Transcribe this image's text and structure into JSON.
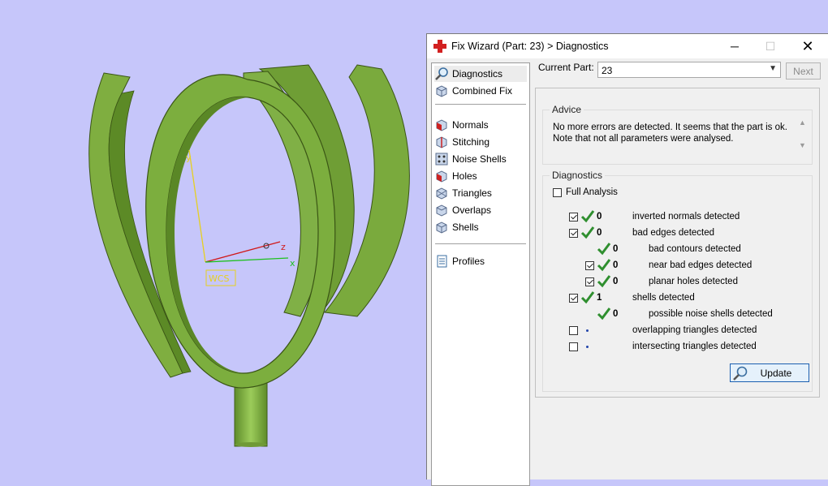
{
  "viewport": {
    "axis_labels": {
      "x": "x",
      "y": "y",
      "z": "z"
    },
    "wcs_label": "WCS"
  },
  "dialog": {
    "title": "Fix Wizard (Part: 23) > Diagnostics",
    "window_buttons": {
      "minimize": "─",
      "maximize": "☐",
      "close": "✕"
    },
    "nav": {
      "items": [
        {
          "label": "Diagnostics",
          "icon": "magnifier-icon"
        },
        {
          "label": "Combined Fix",
          "icon": "cube-icon"
        },
        {
          "label": "Normals",
          "icon": "normals-cube-icon"
        },
        {
          "label": "Stitching",
          "icon": "stitching-cube-icon"
        },
        {
          "label": "Noise Shells",
          "icon": "noise-shells-icon"
        },
        {
          "label": "Holes",
          "icon": "holes-cube-icon"
        },
        {
          "label": "Triangles",
          "icon": "triangles-cube-icon"
        },
        {
          "label": "Overlaps",
          "icon": "overlaps-cube-icon"
        },
        {
          "label": "Shells",
          "icon": "shells-cube-icon"
        },
        {
          "label": "Profiles",
          "icon": "profiles-document-icon"
        }
      ],
      "selected": "Diagnostics"
    },
    "current_part": {
      "label": "Current Part:",
      "value": "23"
    },
    "next_label": "Next",
    "advice": {
      "title": "Advice",
      "line1": "No more errors are detected. It seems that the part is ok.",
      "line2": "Note that not all parameters were analysed."
    },
    "diagnostics": {
      "title": "Diagnostics",
      "full_analysis": {
        "label": "Full Analysis",
        "checked": false
      },
      "rows": [
        {
          "label": "inverted normals detected",
          "count": "0",
          "checked": true
        },
        {
          "label": "bad edges detected",
          "count": "0",
          "checked": true
        },
        {
          "label": "bad contours detected",
          "count": "0"
        },
        {
          "label": "near bad edges detected",
          "count": "0",
          "checked": true
        },
        {
          "label": "planar holes detected",
          "count": "0",
          "checked": true
        },
        {
          "label": "shells detected",
          "count": "1",
          "checked": true
        },
        {
          "label": "possible noise shells detected",
          "count": "0"
        },
        {
          "label": "overlapping triangles detected",
          "count": "",
          "checked": false
        },
        {
          "label": "intersecting triangles detected",
          "count": "",
          "checked": false
        }
      ]
    },
    "update_label": "Update",
    "colors": {
      "model_green": "#76a83c",
      "check_green": "#2f8f2f",
      "background": "#c6c6fa"
    }
  }
}
